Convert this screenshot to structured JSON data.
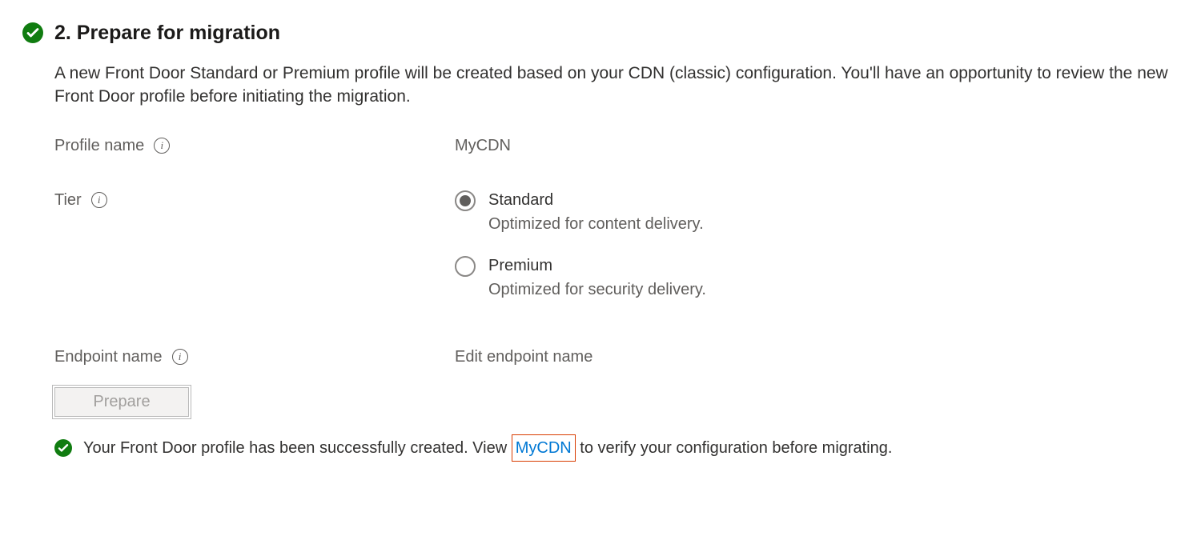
{
  "section": {
    "title": "2. Prepare for migration",
    "description": "A new Front Door Standard or Premium profile will be created based on your CDN (classic) configuration. You'll have an opportunity to review the new Front Door profile before initiating the migration."
  },
  "fields": {
    "profile_label": "Profile name",
    "profile_value": "MyCDN",
    "tier_label": "Tier",
    "tier_options": {
      "standard": {
        "title": "Standard",
        "subtitle": "Optimized for content delivery."
      },
      "premium": {
        "title": "Premium",
        "subtitle": "Optimized for security delivery."
      }
    },
    "endpoint_label": "Endpoint name",
    "endpoint_value": "Edit endpoint name"
  },
  "actions": {
    "prepare_label": "Prepare"
  },
  "status": {
    "prefix": "Your Front Door profile has been successfully created. View ",
    "link_text": "MyCDN",
    "suffix": " to verify your configuration before migrating."
  }
}
